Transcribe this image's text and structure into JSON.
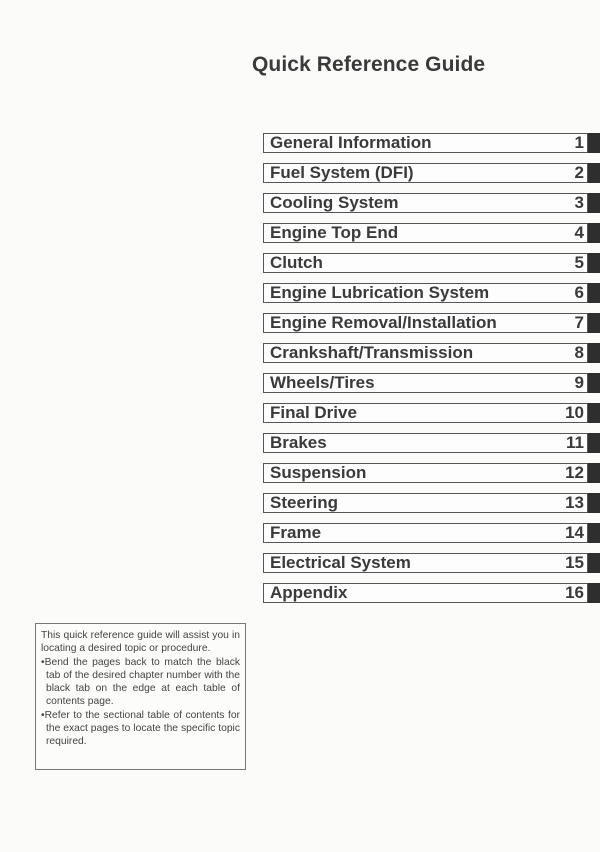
{
  "page": {
    "title": "Quick Reference Guide"
  },
  "toc": {
    "items": [
      {
        "label": "General Information",
        "number": "1"
      },
      {
        "label": "Fuel System (DFI)",
        "number": "2"
      },
      {
        "label": "Cooling System",
        "number": "3"
      },
      {
        "label": "Engine Top End",
        "number": "4"
      },
      {
        "label": "Clutch",
        "number": "5"
      },
      {
        "label": "Engine Lubrication System",
        "number": "6"
      },
      {
        "label": "Engine Removal/Installation",
        "number": "7"
      },
      {
        "label": "Crankshaft/Transmission",
        "number": "8"
      },
      {
        "label": "Wheels/Tires",
        "number": "9"
      },
      {
        "label": "Final Drive",
        "number": "10"
      },
      {
        "label": "Brakes",
        "number": "11"
      },
      {
        "label": "Suspension",
        "number": "12"
      },
      {
        "label": "Steering",
        "number": "13"
      },
      {
        "label": "Frame",
        "number": "14"
      },
      {
        "label": "Electrical System",
        "number": "15"
      },
      {
        "label": "Appendix",
        "number": "16"
      }
    ],
    "tab_color": "#2e2e2e"
  },
  "note": {
    "intro": "This quick reference guide will assist you in locating a desired topic or procedure.",
    "bullets": [
      "•Bend the pages back to match the black tab of the desired chapter number with the black tab on the edge at each table of contents page.",
      "•Refer to the sectional table of contents for the exact pages to locate the specific topic required."
    ]
  }
}
